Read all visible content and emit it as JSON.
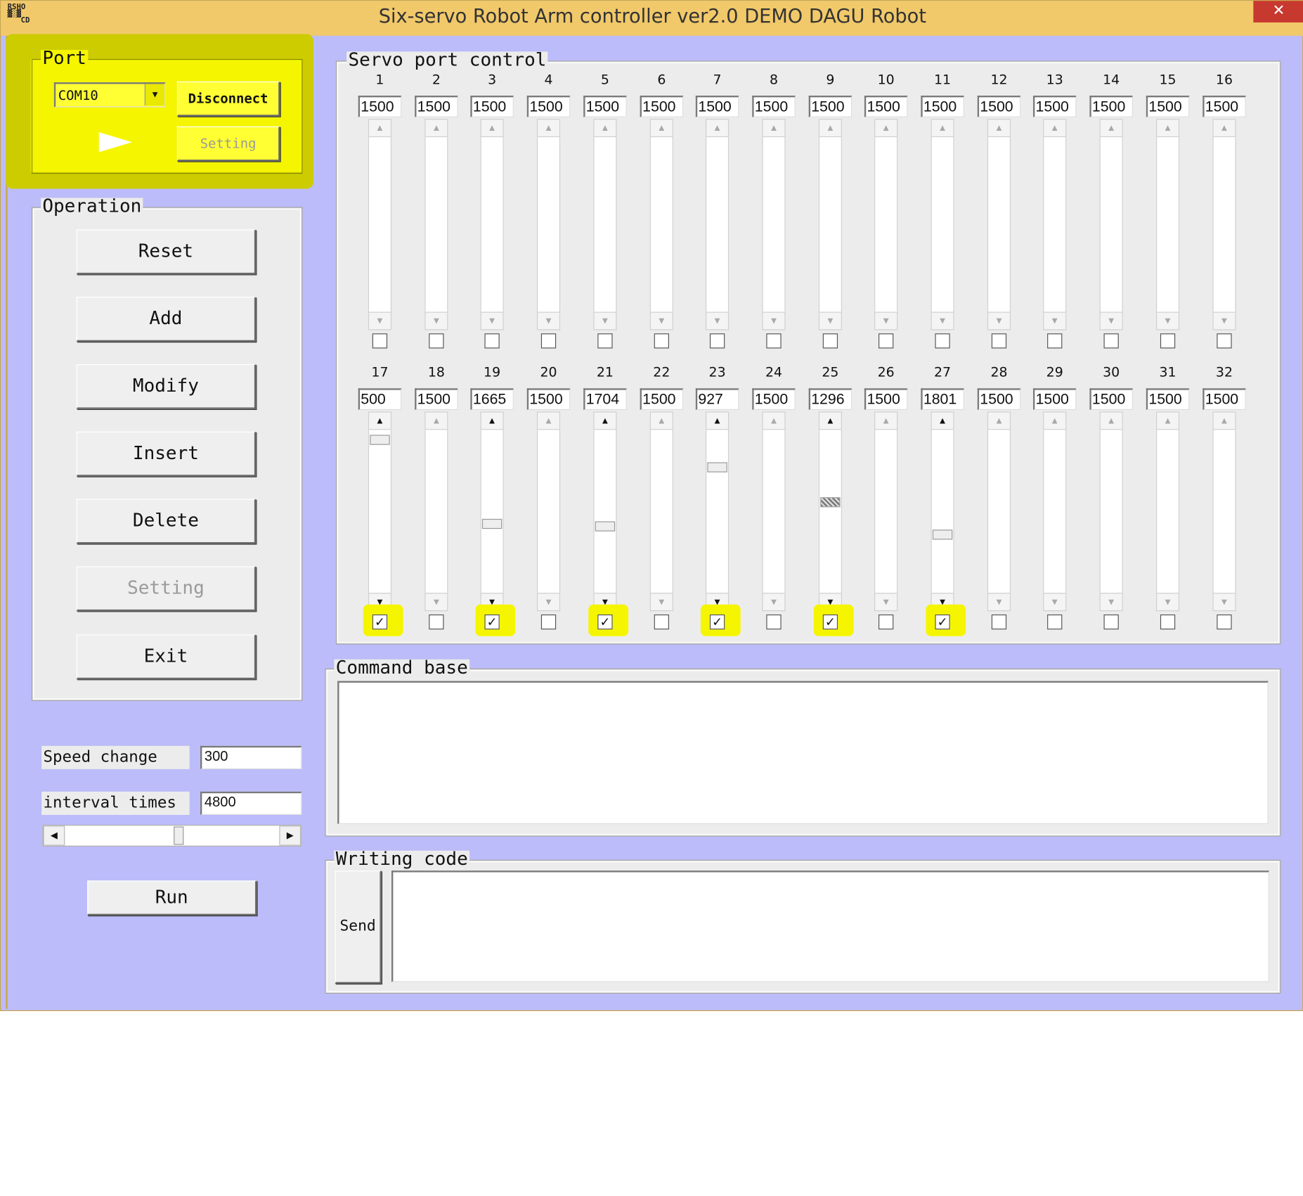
{
  "window": {
    "title": "Six-servo Robot Arm controller ver2.0 DEMO DAGU Robot",
    "close_glyph": "✕",
    "icon_text_line1": "RSHO",
    "icon_text_line2": "▓░▓",
    "icon_text_line3": "CD"
  },
  "port": {
    "legend": "Port",
    "com_value": "COM10",
    "dropdown_glyph": "▼",
    "disconnect_label": "Disconnect",
    "setting_label": "Setting"
  },
  "operation": {
    "legend": "Operation",
    "buttons": [
      "Reset",
      "Add",
      "Modify",
      "Insert",
      "Delete",
      "Setting",
      "Exit"
    ]
  },
  "speed": {
    "label": "Speed change",
    "value": "300"
  },
  "interval": {
    "label": "interval times",
    "value": "4800",
    "slider_position": 0.53
  },
  "run_label": "Run",
  "servo": {
    "legend": "Servo port control",
    "up_glyph": "▲",
    "down_glyph": "▼",
    "row1": {
      "numbers": [
        "1",
        "2",
        "3",
        "4",
        "5",
        "6",
        "7",
        "8",
        "9",
        "10",
        "11",
        "12",
        "13",
        "14",
        "15",
        "16"
      ],
      "values": [
        "1500",
        "1500",
        "1500",
        "1500",
        "1500",
        "1500",
        "1500",
        "1500",
        "1500",
        "1500",
        "1500",
        "1500",
        "1500",
        "1500",
        "1500",
        "1500"
      ],
      "checked": [
        false,
        false,
        false,
        false,
        false,
        false,
        false,
        false,
        false,
        false,
        false,
        false,
        false,
        false,
        false,
        false
      ],
      "thumb_fraction": [
        null,
        null,
        null,
        null,
        null,
        null,
        null,
        null,
        null,
        null,
        null,
        null,
        null,
        null,
        null,
        null
      ]
    },
    "row2": {
      "numbers": [
        "17",
        "18",
        "19",
        "20",
        "21",
        "22",
        "23",
        "24",
        "25",
        "26",
        "27",
        "28",
        "29",
        "30",
        "31",
        "32"
      ],
      "values": [
        "500",
        "1500",
        "1665",
        "1500",
        "1704",
        "1500",
        "927",
        "1500",
        "1296",
        "1500",
        "1801",
        "1500",
        "1500",
        "1500",
        "1500",
        "1500"
      ],
      "checked": [
        true,
        false,
        true,
        false,
        true,
        false,
        true,
        false,
        true,
        false,
        true,
        false,
        false,
        false,
        false,
        false
      ],
      "thumb_fraction": [
        0.03,
        null,
        0.58,
        null,
        0.6,
        null,
        0.21,
        null,
        0.44,
        null,
        0.65,
        null,
        null,
        null,
        null,
        null
      ]
    },
    "check_glyph": "✓"
  },
  "command_base": {
    "legend": "Command base",
    "content": ""
  },
  "writing_code": {
    "legend": "Writing code",
    "send_label": "Send",
    "content": ""
  },
  "colors": {
    "highlight": "#f5f500",
    "titlebar": "#f1c96a",
    "background": "#bcbcfa",
    "close": "#c7392f"
  }
}
